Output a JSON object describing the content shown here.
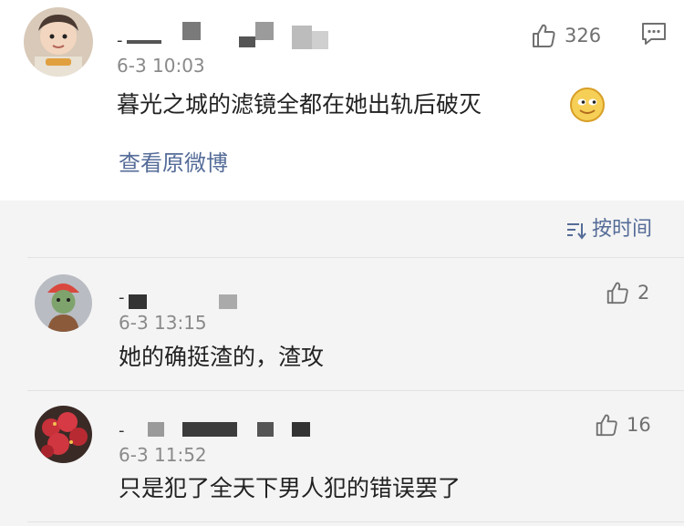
{
  "main_comment": {
    "username_prefix": "-",
    "time": "6-3 10:03",
    "text": "暮光之城的滤镜全都在她出轨后破灭",
    "emoji_icon": "doge-emoji-icon",
    "likes": "326",
    "link_label": "查看原微博"
  },
  "sort": {
    "label": "按时间",
    "icon": "sort-icon"
  },
  "replies": [
    {
      "username_prefix": "-",
      "time": "6-3 13:15",
      "text": "她的确挺渣的，渣攻",
      "likes": "2"
    },
    {
      "username_prefix": "-",
      "time": "6-3 11:52",
      "text": "只是犯了全天下男人犯的错误罢了",
      "likes": "16"
    }
  ],
  "colors": {
    "link": "#556c98",
    "text": "#222222",
    "meta": "#8a8a8a",
    "replies_bg": "#f4f4f4"
  }
}
